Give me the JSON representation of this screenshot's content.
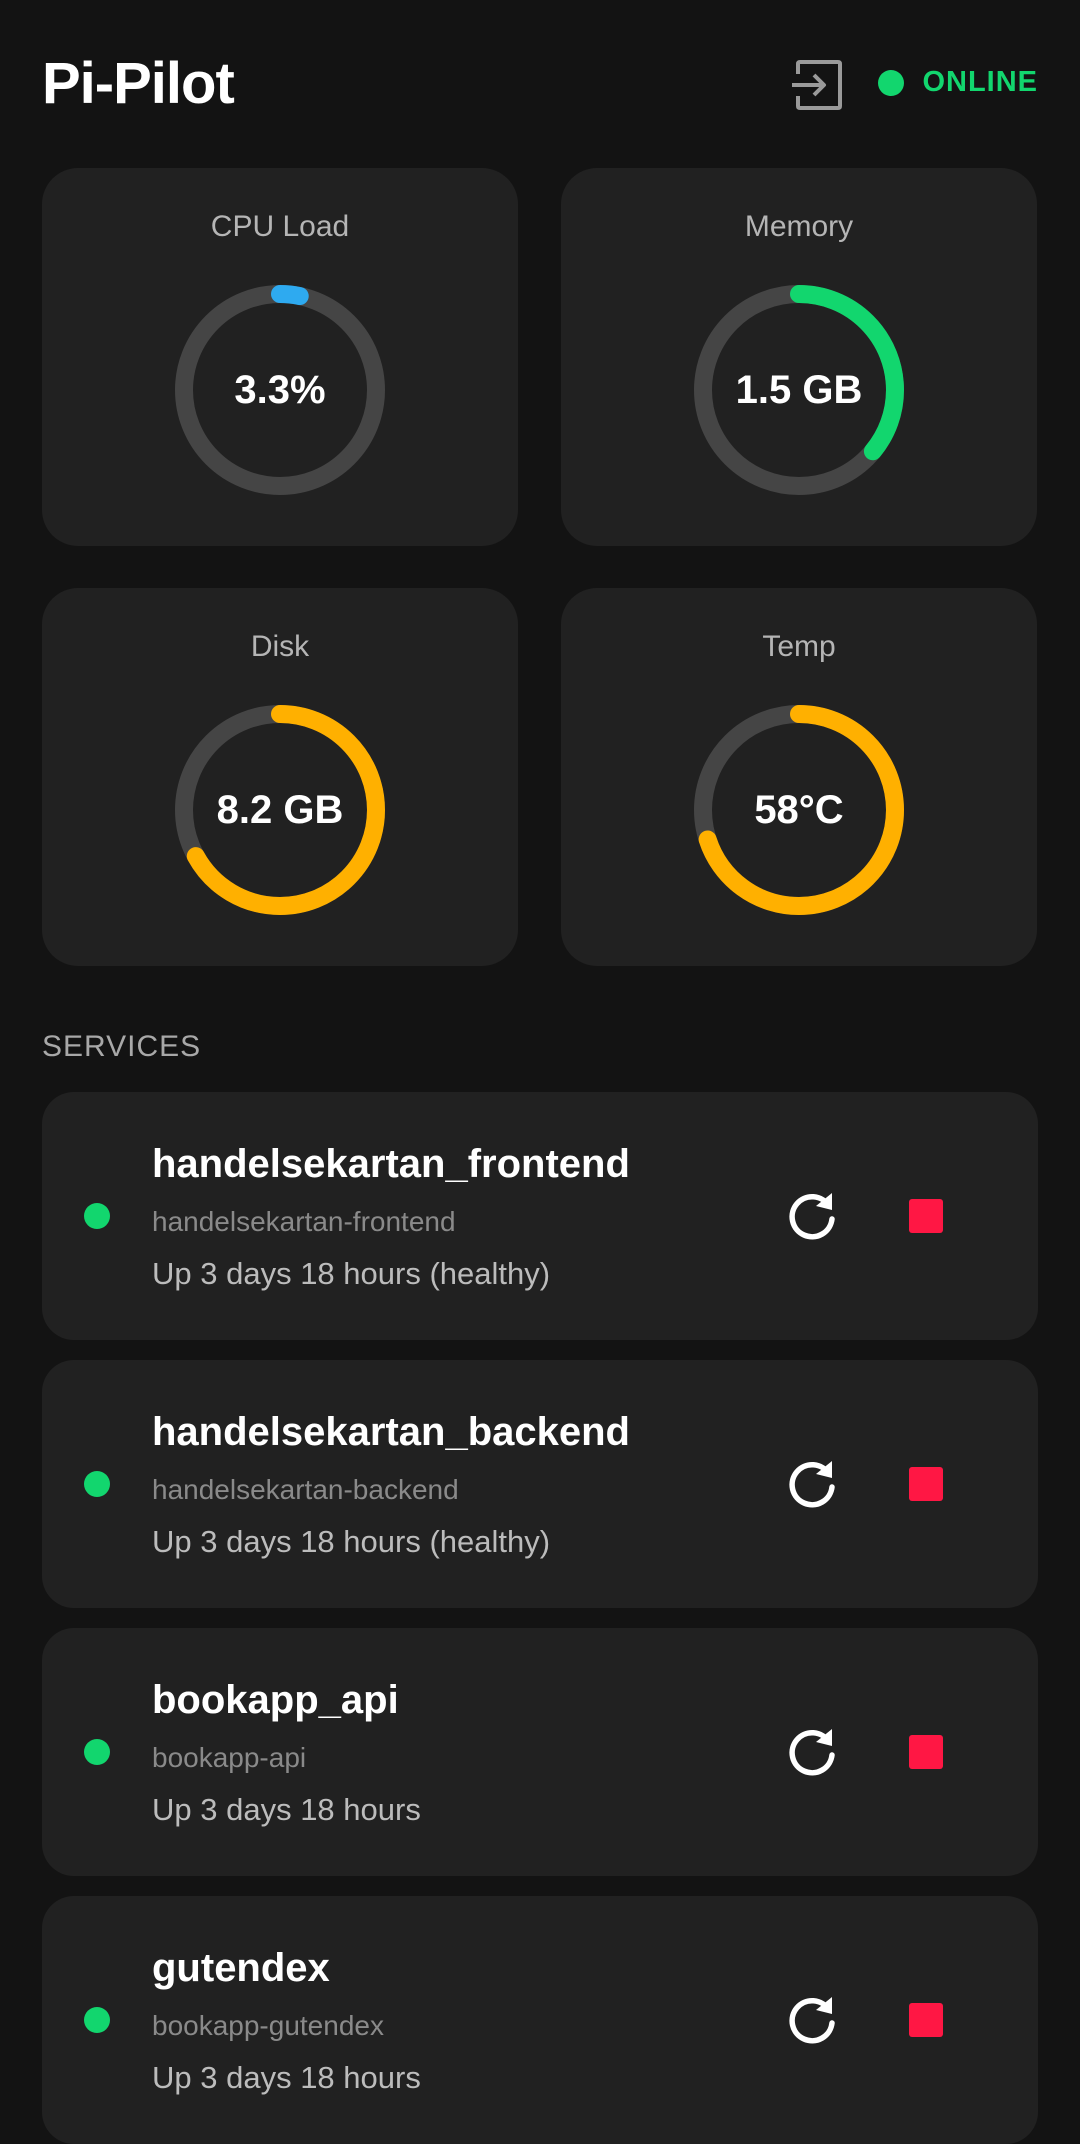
{
  "header": {
    "title": "Pi-Pilot",
    "logout_icon": "logout-icon",
    "status_label": "ONLINE",
    "status_color": "#12d66e"
  },
  "gauges": [
    {
      "label": "CPU Load",
      "value": "3.3%",
      "percent": 3.3,
      "color": "#2eaaf0"
    },
    {
      "label": "Memory",
      "value": "1.5 GB",
      "percent": 36,
      "color": "#12d66e"
    },
    {
      "label": "Disk",
      "value": "8.2 GB",
      "percent": 67,
      "color": "#ffb000"
    },
    {
      "label": "Temp",
      "value": "58°C",
      "percent": 70,
      "color": "#ffb000"
    }
  ],
  "services_label": "SERVICES",
  "services": [
    {
      "name": "handelsekartan_frontend",
      "container": "handelsekartan-frontend",
      "status": "Up 3 days 18 hours (healthy)"
    },
    {
      "name": "handelsekartan_backend",
      "container": "handelsekartan-backend",
      "status": "Up 3 days 18 hours (healthy)"
    },
    {
      "name": "bookapp_api",
      "container": "bookapp-api",
      "status": "Up 3 days 18 hours"
    },
    {
      "name": "gutendex",
      "container": "bookapp-gutendex",
      "status": "Up 3 days 18 hours"
    }
  ],
  "icons": {
    "restart": "restart-icon",
    "stop": "stop-icon"
  },
  "colors": {
    "background": "#131313",
    "card": "#212121",
    "track": "#454545",
    "stop": "#ff1744",
    "running": "#12d66e"
  }
}
